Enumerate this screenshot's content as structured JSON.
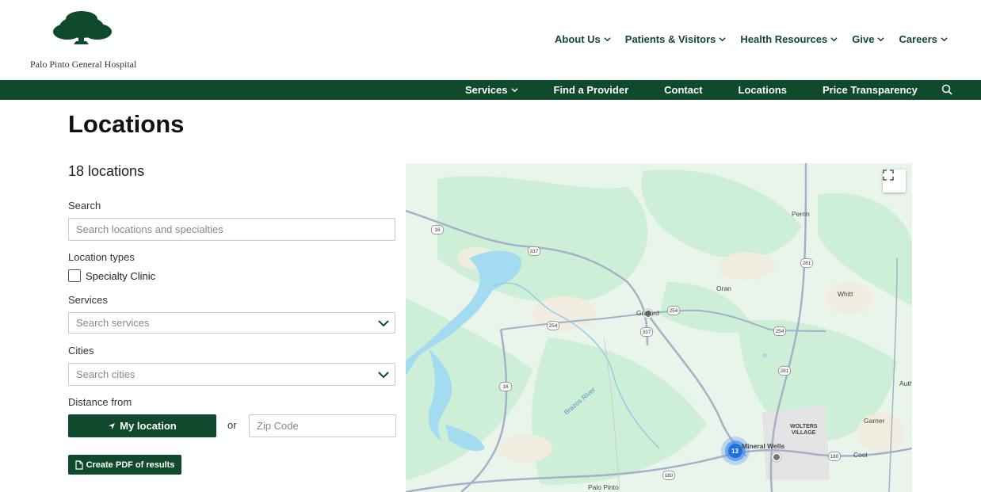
{
  "brand": {
    "name": "Palo Pinto General Hospital",
    "primary_color": "#0f4a2c"
  },
  "top_nav": [
    {
      "label": "About Us"
    },
    {
      "label": "Patients & Visitors"
    },
    {
      "label": "Health Resources"
    },
    {
      "label": "Give"
    },
    {
      "label": "Careers"
    }
  ],
  "main_nav": [
    {
      "label": "Services",
      "has_dropdown": true
    },
    {
      "label": "Find a Provider"
    },
    {
      "label": "Contact"
    },
    {
      "label": "Locations"
    },
    {
      "label": "Price Transparency"
    }
  ],
  "page": {
    "title": "Locations",
    "count": "18 locations"
  },
  "filters": {
    "search_label": "Search",
    "search_placeholder": "Search locations and specialties",
    "location_types_label": "Location types",
    "location_type_option": "Specialty Clinic",
    "services_label": "Services",
    "services_placeholder": "Search services",
    "cities_label": "Cities",
    "cities_placeholder": "Search cities",
    "distance_label": "Distance from",
    "my_location": "My location",
    "or": "or",
    "zip_placeholder": "Zip Code",
    "pdf_button": "Create PDF of results"
  },
  "map": {
    "places": [
      "Perrin",
      "Oran",
      "Whitt",
      "Graford",
      "Mineral Wells",
      "WOLTERS",
      "VILLAGE",
      "Garner",
      "Cool",
      "Auth",
      "Palo Pinto",
      "Brazos River"
    ],
    "route_shields": [
      "16",
      "337",
      "254",
      "337",
      "254",
      "281",
      "281",
      "254",
      "16",
      "180",
      "180"
    ],
    "cluster_count": "13"
  }
}
